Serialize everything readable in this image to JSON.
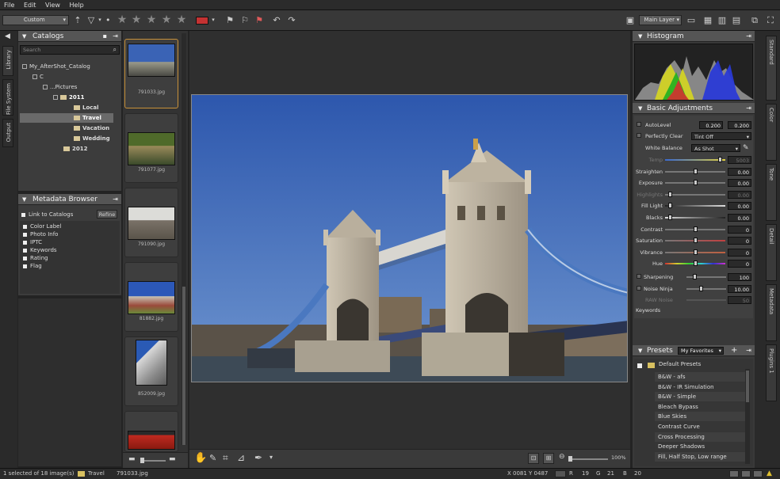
{
  "menu": {
    "file": "File",
    "edit": "Edit",
    "view": "View",
    "help": "Help"
  },
  "toolbar": {
    "preset_select": "Custom",
    "layer_select": "Main Layer"
  },
  "catalogs": {
    "title": "Catalogs",
    "search_placeholder": "Search",
    "tree": [
      {
        "label": "My_AfterShot_Catalog"
      },
      {
        "label": "C"
      },
      {
        "label": "...Pictures"
      },
      {
        "label": "2011"
      },
      {
        "label": "Local"
      },
      {
        "label": "Travel"
      },
      {
        "label": "Vacation"
      },
      {
        "label": "Wedding"
      },
      {
        "label": "2012"
      }
    ]
  },
  "left_tabs": {
    "library": "Library",
    "file_system": "File System",
    "output": "Output"
  },
  "metadata": {
    "title": "Metadata Browser",
    "link": "Link to Catalogs",
    "refine": "Refine",
    "items": [
      "Color Label",
      "Photo Info",
      "IPTC",
      "Keywords",
      "Rating",
      "Flag"
    ]
  },
  "thumbnails": [
    {
      "caption": "791033.jpg"
    },
    {
      "caption": "791077.jpg"
    },
    {
      "caption": "791090.jpg"
    },
    {
      "caption": "81882.jpg"
    },
    {
      "caption": "852009.jpg"
    },
    {
      "caption": ""
    }
  ],
  "histogram": {
    "title": "Histogram"
  },
  "basic": {
    "title": "Basic Adjustments",
    "autolevel": "AutoLevel",
    "autolevel_v1": "0.200",
    "autolevel_v2": "0.200",
    "perfectly_clear": "Perfectly Clear",
    "perfectly_clear_val": "Tint Off",
    "white_balance": "White Balance",
    "white_balance_val": "As Shot",
    "rows": [
      {
        "label": "Temp",
        "value": "5003",
        "knob": 0.95
      },
      {
        "label": "Straighten",
        "value": "0.00",
        "knob": 0.5
      },
      {
        "label": "Exposure",
        "value": "0.00",
        "knob": 0.5
      },
      {
        "label": "Highlights",
        "value": "0.00",
        "knob": 0.05
      },
      {
        "label": "Fill Light",
        "value": "0.00",
        "knob": 0.05
      },
      {
        "label": "Blacks",
        "value": "0.00",
        "knob": 0.05
      },
      {
        "label": "Contrast",
        "value": "0",
        "knob": 0.5
      },
      {
        "label": "Saturation",
        "value": "0",
        "knob": 0.5
      },
      {
        "label": "Vibrance",
        "value": "0",
        "knob": 0.5
      },
      {
        "label": "Hue",
        "value": "0",
        "knob": 0.5
      }
    ],
    "sharpening": "Sharpening",
    "sharpening_val": "100",
    "noise_ninja": "Noise Ninja",
    "noise_val": "10.00",
    "rows2_3": "RAW Noise",
    "rows2_3_val": "50",
    "keywords": "Keywords"
  },
  "right_tabs": {
    "standard": "Standard",
    "color": "Color",
    "tone": "Tone",
    "detail": "Detail",
    "metadata": "Metadata",
    "plugins": "Plugins 1"
  },
  "presets": {
    "title": "Presets",
    "filter": "My Favorites",
    "group": "Default Presets",
    "items": [
      "B&W - afs",
      "B&W - IR Simulation",
      "B&W - Simple",
      "Bleach Bypass",
      "Blue Skies",
      "Contrast Curve",
      "Cross Processing",
      "Deeper Shadows",
      "Fill, Half Stop, Low range"
    ]
  },
  "viewer": {
    "zoom": "100%"
  },
  "status": {
    "selected": "1 selected of 18 image(s)",
    "folder": "Travel",
    "file": "791033.jpg",
    "coords": "X 0081  Y 0487",
    "r": "R",
    "r_val": "19",
    "g": "G",
    "g_val": "21",
    "b": "B",
    "b_val": "20"
  },
  "colors": {
    "accent": "#c8913a",
    "panel_bg": "#3c3c3c",
    "header": "#555555",
    "sky": "#3a63b5"
  }
}
